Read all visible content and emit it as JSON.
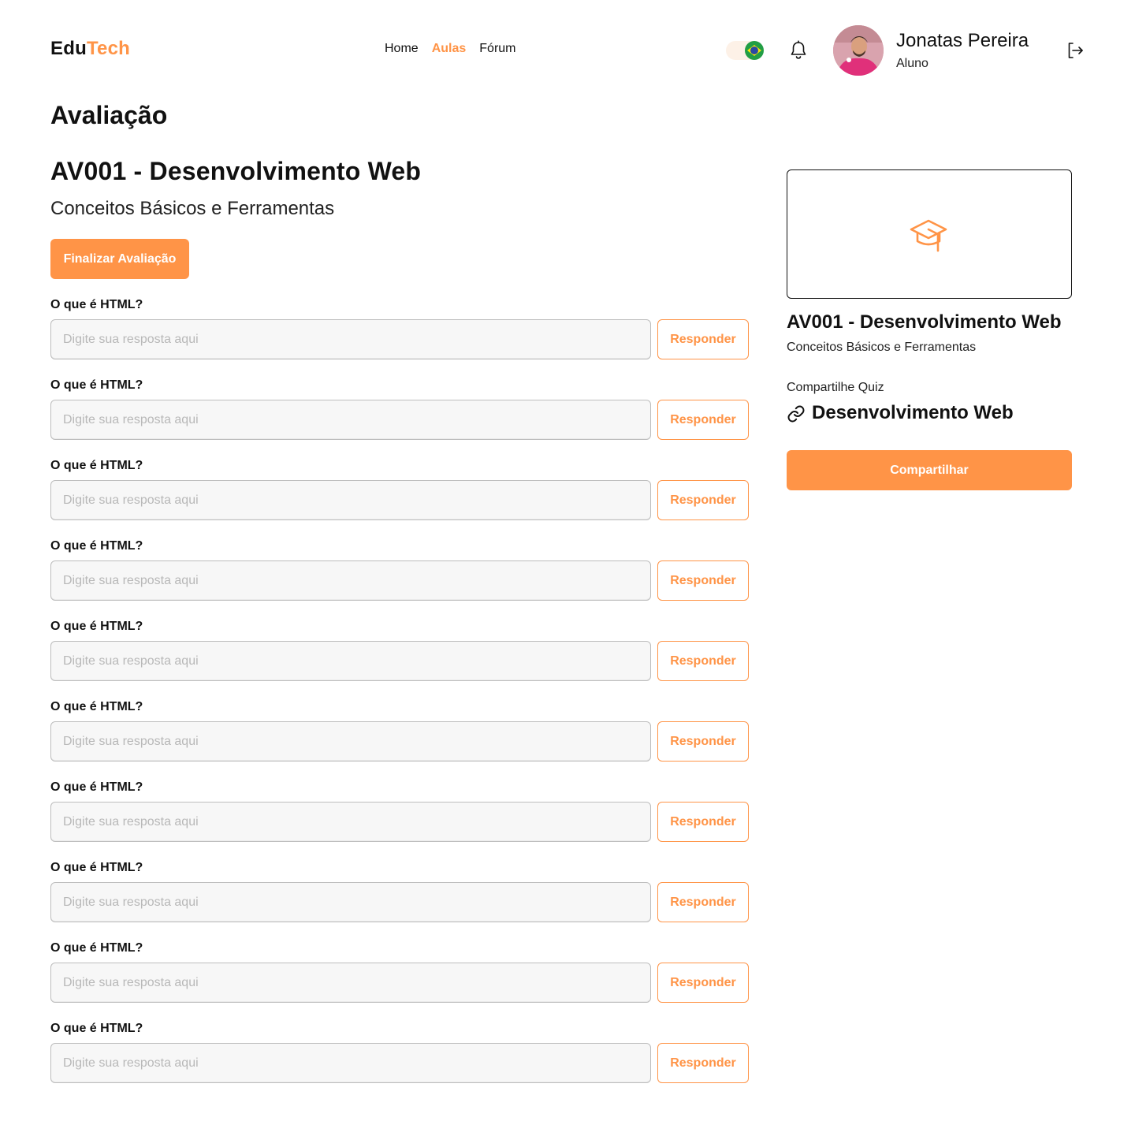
{
  "brand": {
    "part1": "Edu",
    "part2": "Tech"
  },
  "nav": {
    "home": "Home",
    "aulas": "Aulas",
    "forum": "Fórum",
    "active": "Aulas"
  },
  "user": {
    "name": "Jonatas Pereira",
    "role": "Aluno"
  },
  "page": {
    "title": "Avaliação"
  },
  "quiz": {
    "title": "AV001 - Desenvolvimento Web",
    "subtitle": "Conceitos Básicos e Ferramentas",
    "finish_label": "Finalizar Avaliação"
  },
  "questions": [
    {
      "label": "O que é HTML?",
      "placeholder": "Digite sua resposta aqui",
      "button": "Responder"
    },
    {
      "label": "O que é HTML?",
      "placeholder": "Digite sua resposta aqui",
      "button": "Responder"
    },
    {
      "label": "O que é HTML?",
      "placeholder": "Digite sua resposta aqui",
      "button": "Responder"
    },
    {
      "label": "O que é HTML?",
      "placeholder": "Digite sua resposta aqui",
      "button": "Responder"
    },
    {
      "label": "O que é HTML?",
      "placeholder": "Digite sua resposta aqui",
      "button": "Responder"
    },
    {
      "label": "O que é HTML?",
      "placeholder": "Digite sua resposta aqui",
      "button": "Responder"
    },
    {
      "label": "O que é HTML?",
      "placeholder": "Digite sua resposta aqui",
      "button": "Responder"
    },
    {
      "label": "O que é HTML?",
      "placeholder": "Digite sua resposta aqui",
      "button": "Responder"
    },
    {
      "label": "O que é HTML?",
      "placeholder": "Digite sua resposta aqui",
      "button": "Responder"
    },
    {
      "label": "O que é HTML?",
      "placeholder": "Digite sua resposta aqui",
      "button": "Responder"
    }
  ],
  "sidebar": {
    "card_icon": "graduation-cap-icon",
    "title": "AV001 - Desenvolvimento Web",
    "subtitle": "Conceitos Básicos e Ferramentas",
    "share_label": "Compartilhe Quiz",
    "share_link": "Desenvolvimento Web",
    "share_button": "Compartilhar"
  },
  "colors": {
    "accent": "#FF9447",
    "text": "#111111",
    "input_bg": "#F7F7F7",
    "input_border": "#BDBDBD"
  }
}
